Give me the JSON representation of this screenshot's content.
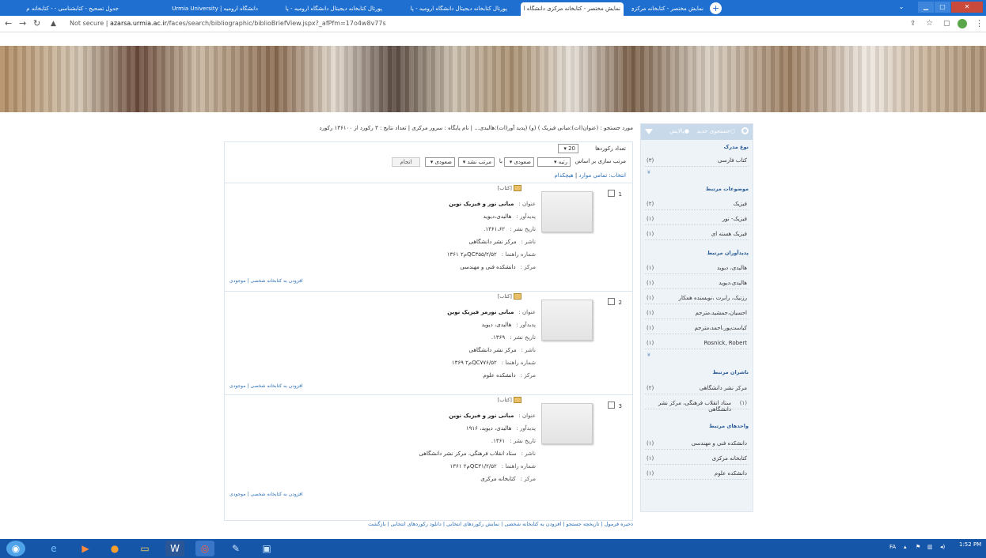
{
  "browser": {
    "tabs": [
      {
        "title": "نمایش مختصر - کتابخانه مرکزی دانشگاه ا",
        "active": false
      },
      {
        "title": "نمایش مختصر - کتابخانه مرکزی دانشگاه ا",
        "active": true
      },
      {
        "title": "پورتال کتابخانه دیجیتال دانشگاه ارومیه - پا",
        "active": false
      },
      {
        "title": "پورتال کتابخانه دیجیتال دانشگاه ارومیه - پا",
        "active": false
      },
      {
        "title": "دانشگاه ارومیه | Urmia University",
        "active": false
      },
      {
        "title": "جدول تصحیح - کتابشناسی - - کتابخانه م",
        "active": false
      }
    ],
    "new_tab": "+",
    "url_warning": "Not secure",
    "url_host": "azarsa.urmia.ac.ir",
    "url_path": "/faces/search/bibliographic/biblioBriefView.jspx?_afPfm=17o4w8v77s"
  },
  "sidebar": {
    "search_option_new": "جستجوی جدید",
    "search_option_refine": "پالایش",
    "sections": [
      {
        "title": "نوع مدرک",
        "items": [
          {
            "label": "کتاب فارسی",
            "count": "(۳)"
          }
        ],
        "more": "¥"
      },
      {
        "title": "موضوعات مرتبط",
        "items": [
          {
            "label": "فیزیک",
            "count": "(۲)"
          },
          {
            "label": "فیزیک- نور",
            "count": "(۱)"
          },
          {
            "label": "فیزیک هسته ای",
            "count": "(۱)"
          }
        ]
      },
      {
        "title": "پدیدآوران مرتبط",
        "items": [
          {
            "label": "هالیدی، دیوید",
            "count": "(۱)"
          },
          {
            "label": "هالیدی،دیوید",
            "count": "(۱)"
          },
          {
            "label": "رزنیک، رابرت ،نویسنده همکار",
            "count": "(۱)"
          },
          {
            "label": "احسیان،جمشید،مترجم",
            "count": "(۱)"
          },
          {
            "label": "کیاست‌پور،احمد،مترجم",
            "count": "(۱)"
          },
          {
            "label": "Rosnick, Robert",
            "count": "(۱)"
          }
        ],
        "more": "¥"
      },
      {
        "title": "ناشران مرتبط",
        "items": [
          {
            "label": "مرکز نشر دانشگاهی",
            "count": "(۲)"
          },
          {
            "label": "ستاد انقلاب فرهنگی، مرکز نشر دانشگاهی",
            "count": "(۱)"
          }
        ]
      },
      {
        "title": "واحدهای مرتبط",
        "items": [
          {
            "label": "دانشکده فنی و مهندسی",
            "count": "(۱)"
          },
          {
            "label": "کتابخانه مرکزی",
            "count": "(۱)"
          },
          {
            "label": "دانشکده علوم",
            "count": "(۱)"
          }
        ]
      }
    ]
  },
  "query": "مورد جستجو : (عنوان(ات):مبانی فیزیک ) (و) (پدید آور(ات):هالیدی... | نام پایگاه : سرور مرکزی | تعداد نتایج : ۳ رکورد از ۱۳۶۱۰۰ رکورد",
  "controls": {
    "records_label": "تعداد رکوردها",
    "records_value": "20",
    "sort_label": "مرتب سازی بر اساس",
    "sort_field": "رتبه",
    "sort_dir1": "صعودی",
    "sort_sep": "با",
    "sort_field2": "مرتب نشد",
    "sort_dir2": "صعودی",
    "apply": "انجام",
    "select_label": "انتخاب:",
    "select_all": "تمامی موارد",
    "select_none": "هیچکدام"
  },
  "records": [
    {
      "num": "1",
      "type": "[کتاب]",
      "fields": [
        {
          "k": "عنوان :",
          "v": "مبانی نور و فیزیک نوین",
          "bold": true
        },
        {
          "k": "پدیدآور :",
          "v": "هالیدی،دیوید"
        },
        {
          "k": "تاریخ نشر :",
          "v": "۱۳۶۱،۶۲."
        },
        {
          "k": "ناشر :",
          "v": "مرکز نشر دانشگاهی"
        },
        {
          "k": "شماره راهنما :",
          "v": "QC۳۵۵/۲/۵۲م۲ ۱۳۶۱"
        },
        {
          "k": "مرکز :",
          "v": "دانشکده فنی و مهندسی"
        }
      ],
      "links": "افزودن به کتابخانه شخصی | موجودی"
    },
    {
      "num": "2",
      "type": "[کتاب]",
      "fields": [
        {
          "k": "عنوان :",
          "v": "مبانی نورمر فیزیک نوین",
          "bold": true
        },
        {
          "k": "پدیدآور :",
          "v": "هالیدی، دیوید"
        },
        {
          "k": "تاریخ نشر :",
          "v": "۱۳۶۹."
        },
        {
          "k": "ناشر :",
          "v": "مرکز نشر دانشگاهی"
        },
        {
          "k": "شماره راهنما :",
          "v": "QC۷۷۶/۵۲م۲ ۱۳۶۹"
        },
        {
          "k": "مرکز :",
          "v": "دانشکده علوم"
        }
      ],
      "links": "افزودن به کتابخانه شخصی | موجودی"
    },
    {
      "num": "3",
      "type": "[کتاب]",
      "fields": [
        {
          "k": "عنوان :",
          "v": "مبانی نور و فیزیک نوین",
          "bold": true
        },
        {
          "k": "پدیدآور :",
          "v": "هالیدی، دیوید، ۱۹۱۶"
        },
        {
          "k": "تاریخ نشر :",
          "v": "۱۳۶۱."
        },
        {
          "k": "ناشر :",
          "v": "ستاد انقلاب فرهنگی، مرکز نشر دانشگاهی"
        },
        {
          "k": "شماره راهنما :",
          "v": "QC۳۱/۲/۵۲م۲ ۱۳۶۱"
        },
        {
          "k": "مرکز :",
          "v": "کتابخانه مرکزی"
        }
      ],
      "links": "افزودن به کتابخانه شخصی | موجودی"
    }
  ],
  "bottom_actions": "ذخیره فرمول | تاریخچه جستجو | افزودن به کتابخانه شخصی | نمایش رکوردهای انتخابی | دانلود رکوردهای انتخابی | بازگشت",
  "taskbar": {
    "lang": "FA",
    "time": "1:52 PM"
  }
}
